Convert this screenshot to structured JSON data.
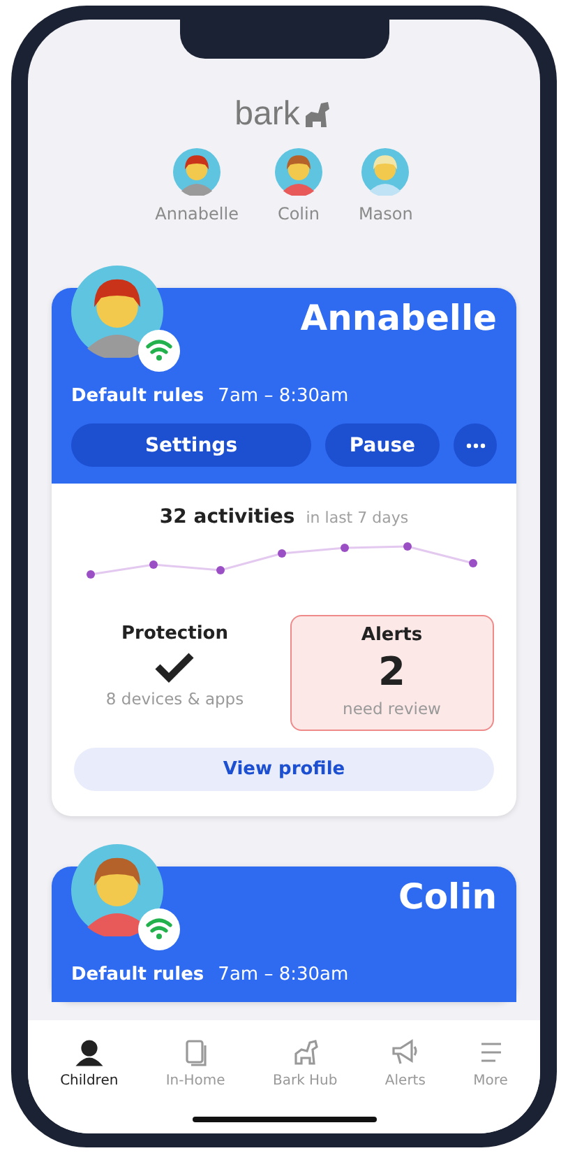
{
  "logo": {
    "text": "bark"
  },
  "children": [
    {
      "name": "Annabelle"
    },
    {
      "name": "Colin"
    },
    {
      "name": "Mason"
    }
  ],
  "cards": [
    {
      "name": "Annabelle",
      "rules_label": "Default rules",
      "rules_time": "7am – 8:30am",
      "buttons": [
        {
          "kind": "wide",
          "label": "Settings"
        },
        {
          "kind": "normal",
          "label": "Pause"
        },
        {
          "kind": "more"
        }
      ],
      "activities_count": "32 activities",
      "activities_period": "in last 7 days",
      "protection": {
        "title": "Protection",
        "detail": "8 devices & apps"
      },
      "alerts": {
        "title": "Alerts",
        "count": "2",
        "detail": "need review"
      },
      "view_profile": "View profile"
    },
    {
      "name": "Colin",
      "rules_label": "Default rules",
      "rules_time": "7am – 8:30am"
    }
  ],
  "tabs": [
    {
      "label": "Children",
      "selected": true
    },
    {
      "label": "In-Home",
      "selected": false
    },
    {
      "label": "Bark Hub",
      "selected": false
    },
    {
      "label": "Alerts",
      "selected": false
    },
    {
      "label": "More",
      "selected": false
    }
  ]
}
